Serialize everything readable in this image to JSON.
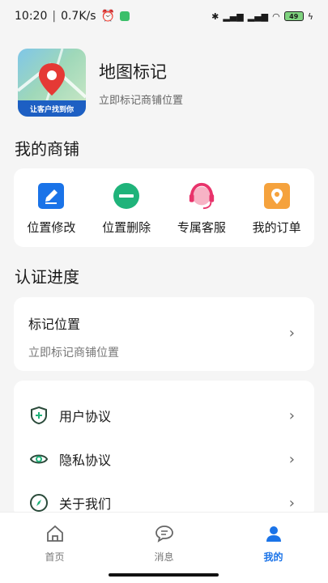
{
  "status_bar": {
    "time": "10:20",
    "speed": "0.7K/s",
    "battery": "49"
  },
  "app": {
    "title": "地图标记",
    "subtitle": "立即标记商铺位置",
    "logo_banner": "让客户找到你"
  },
  "shop": {
    "section_title": "我的商铺",
    "items": [
      {
        "label": "位置修改",
        "icon": "edit-icon",
        "color": "#1a73e8"
      },
      {
        "label": "位置删除",
        "icon": "remove-icon",
        "color": "#1fb37a"
      },
      {
        "label": "专属客服",
        "icon": "headset-icon",
        "color": "#e8336b"
      },
      {
        "label": "我的订单",
        "icon": "location-pin-icon",
        "color": "#f5a23d"
      }
    ]
  },
  "progress": {
    "section_title": "认证进度",
    "title": "标记位置",
    "subtitle": "立即标记商铺位置"
  },
  "menu": {
    "items": [
      {
        "label": "用户协议",
        "icon": "shield-plus-icon"
      },
      {
        "label": "隐私协议",
        "icon": "eye-icon"
      },
      {
        "label": "关于我们",
        "icon": "compass-icon"
      }
    ]
  },
  "tabbar": {
    "tabs": [
      {
        "label": "首页",
        "icon": "home-icon",
        "active": false
      },
      {
        "label": "消息",
        "icon": "message-icon",
        "active": false
      },
      {
        "label": "我的",
        "icon": "user-icon",
        "active": true
      }
    ]
  },
  "colors": {
    "accent": "#1a73e8",
    "icon_green": "#1fb37a",
    "menu_icon": "#2a4a3a"
  }
}
